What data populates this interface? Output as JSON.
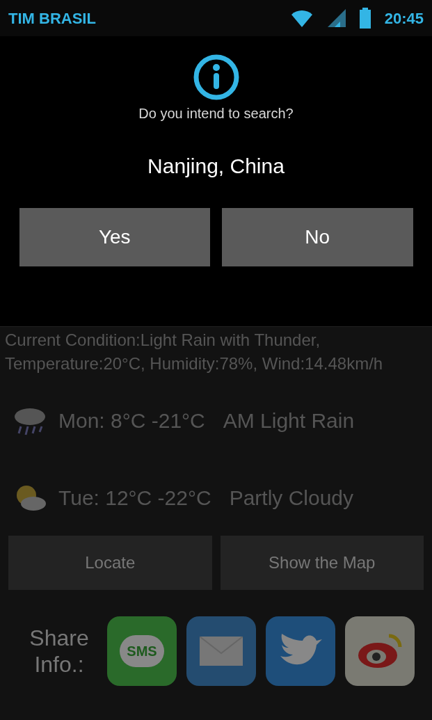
{
  "status_bar": {
    "carrier": "TIM BRASIL",
    "time": "20:45"
  },
  "dialog": {
    "question": "Do you intend to search?",
    "place": "Nanjing, China",
    "buttons": [
      "Yes",
      "No"
    ]
  },
  "current": "Current Condition:Light Rain with Thunder, Temperature:20°C, Humidity:78%, Wind:14.48km/h",
  "forecast": [
    {
      "kind": "rain",
      "day": "Mon: 8°C -21°C",
      "condition": "AM Light Rain"
    },
    {
      "kind": "partly-cloudy",
      "day": "Tue: 12°C -22°C",
      "condition": "Partly Cloudy"
    }
  ],
  "actions": [
    "Locate",
    "Show the Map"
  ],
  "share": {
    "label": "Share Info.:",
    "apps": [
      {
        "kind": "sms",
        "label": "SMS"
      },
      {
        "kind": "mail"
      },
      {
        "kind": "bird"
      },
      {
        "kind": "weibo"
      }
    ]
  }
}
